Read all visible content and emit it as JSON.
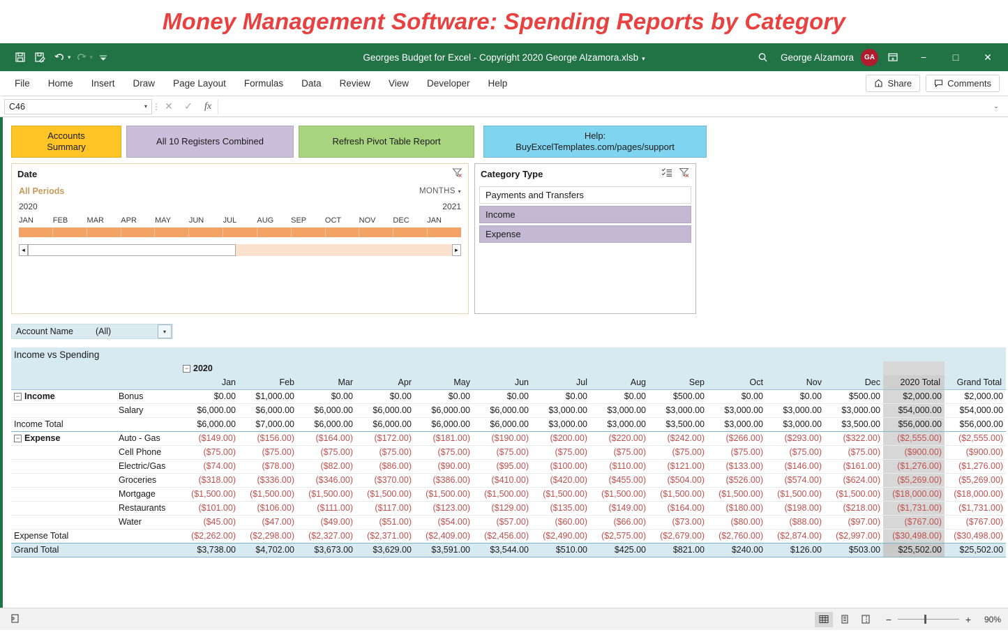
{
  "banner": {
    "title": "Money Management Software: Spending Reports by Category"
  },
  "titlebar": {
    "document_title": "Georges Budget for Excel - Copyright 2020 George Alzamora.xlsb",
    "title_caret": "▾",
    "quick_access": [
      {
        "name": "save-icon",
        "glyph": "Ὃe"
      },
      {
        "name": "save-as-icon",
        "glyph": "✎"
      },
      {
        "name": "undo-icon",
        "glyph": "↶"
      },
      {
        "name": "redo-icon",
        "glyph": "↷"
      },
      {
        "name": "customize-qat-icon",
        "glyph": "⌄"
      }
    ],
    "search_icon": "⚲",
    "user_name": "George Alzamora",
    "user_initials": "GA",
    "ribbon_display_icon": "⌧",
    "minimize": "−",
    "maximize": "□",
    "close": "✕"
  },
  "ribbon": {
    "tabs": [
      "File",
      "Home",
      "Insert",
      "Draw",
      "Page Layout",
      "Formulas",
      "Data",
      "Review",
      "View",
      "Developer",
      "Help"
    ],
    "share_label": "Share",
    "share_icon": "↪",
    "comments_label": "Comments",
    "comments_icon": "⬚"
  },
  "formula_bar": {
    "name_box": "C46",
    "name_box_caret": "▾",
    "cancel_icon": "✕",
    "confirm_icon": "✓",
    "function_icon": "fx",
    "formula_value": "",
    "expand_icon": "⌄"
  },
  "nav_buttons": [
    {
      "name": "accounts-summary-button",
      "line1": "Accounts",
      "line2": "Summary",
      "color": "#ffc425"
    },
    {
      "name": "all-registers-button",
      "line1": "All 10 Registers Combined",
      "line2": "",
      "color": "#cbbedb"
    },
    {
      "name": "refresh-pivot-button",
      "line1": "Refresh Pivot Table Report",
      "line2": "",
      "color": "#a9d47f"
    },
    {
      "name": "help-button",
      "line1": "Help:",
      "line2": "BuyExcelTemplates.com/pages/support",
      "color": "#7fd4ef"
    }
  ],
  "timeline_slicer": {
    "title": "Date",
    "clear_filter_icon": "∇",
    "all_periods": "All Periods",
    "level": "MONTHS",
    "level_caret": "▾",
    "year_start": "2020",
    "year_end": "2021",
    "months": [
      "JAN",
      "FEB",
      "MAR",
      "APR",
      "MAY",
      "JUN",
      "JUL",
      "AUG",
      "SEP",
      "OCT",
      "NOV",
      "DEC",
      "JAN"
    ],
    "scroll_left": "◄",
    "scroll_right": "►",
    "bar_color": "#f2a365"
  },
  "category_slicer": {
    "title": "Category Type",
    "multiselect_icon": "≣",
    "clear_filter_icon": "∇",
    "items": [
      {
        "label": "Payments and Transfers",
        "selected": false
      },
      {
        "label": "Income",
        "selected": true
      },
      {
        "label": "Expense",
        "selected": true
      }
    ]
  },
  "account_filter": {
    "label": "Account Name",
    "value": "(All)",
    "caret": "▾"
  },
  "chart_data": {
    "type": "table",
    "title": "Income vs Spending",
    "year_group": "2020",
    "year_collapse_glyph": "−",
    "columns": [
      "Jan",
      "Feb",
      "Mar",
      "Apr",
      "May",
      "Jun",
      "Jul",
      "Aug",
      "Sep",
      "Oct",
      "Nov",
      "Dec"
    ],
    "total_columns": [
      "2020 Total",
      "Grand Total"
    ],
    "groups": [
      {
        "name": "Income",
        "collapse_glyph": "−",
        "rows": [
          {
            "label": "Bonus",
            "values": [
              "$0.00",
              "$1,000.00",
              "$0.00",
              "$0.00",
              "$0.00",
              "$0.00",
              "$0.00",
              "$0.00",
              "$500.00",
              "$0.00",
              "$0.00",
              "$500.00"
            ],
            "year_total": "$2,000.00",
            "grand_total": "$2,000.00",
            "negative": false
          },
          {
            "label": "Salary",
            "values": [
              "$6,000.00",
              "$6,000.00",
              "$6,000.00",
              "$6,000.00",
              "$6,000.00",
              "$6,000.00",
              "$3,000.00",
              "$3,000.00",
              "$3,000.00",
              "$3,000.00",
              "$3,000.00",
              "$3,000.00"
            ],
            "year_total": "$54,000.00",
            "grand_total": "$54,000.00",
            "negative": false
          }
        ],
        "total_label": "Income Total",
        "total_values": [
          "$6,000.00",
          "$7,000.00",
          "$6,000.00",
          "$6,000.00",
          "$6,000.00",
          "$6,000.00",
          "$3,000.00",
          "$3,000.00",
          "$3,500.00",
          "$3,000.00",
          "$3,000.00",
          "$3,500.00"
        ],
        "total_year": "$56,000.00",
        "total_grand": "$56,000.00",
        "total_negative": false
      },
      {
        "name": "Expense",
        "collapse_glyph": "−",
        "rows": [
          {
            "label": "Auto - Gas",
            "values": [
              "($149.00)",
              "($156.00)",
              "($164.00)",
              "($172.00)",
              "($181.00)",
              "($190.00)",
              "($200.00)",
              "($220.00)",
              "($242.00)",
              "($266.00)",
              "($293.00)",
              "($322.00)"
            ],
            "year_total": "($2,555.00)",
            "grand_total": "($2,555.00)",
            "negative": true
          },
          {
            "label": "Cell Phone",
            "values": [
              "($75.00)",
              "($75.00)",
              "($75.00)",
              "($75.00)",
              "($75.00)",
              "($75.00)",
              "($75.00)",
              "($75.00)",
              "($75.00)",
              "($75.00)",
              "($75.00)",
              "($75.00)"
            ],
            "year_total": "($900.00)",
            "grand_total": "($900.00)",
            "negative": true
          },
          {
            "label": "Electric/Gas",
            "values": [
              "($74.00)",
              "($78.00)",
              "($82.00)",
              "($86.00)",
              "($90.00)",
              "($95.00)",
              "($100.00)",
              "($110.00)",
              "($121.00)",
              "($133.00)",
              "($146.00)",
              "($161.00)"
            ],
            "year_total": "($1,276.00)",
            "grand_total": "($1,276.00)",
            "negative": true
          },
          {
            "label": "Groceries",
            "values": [
              "($318.00)",
              "($336.00)",
              "($346.00)",
              "($370.00)",
              "($386.00)",
              "($410.00)",
              "($420.00)",
              "($455.00)",
              "($504.00)",
              "($526.00)",
              "($574.00)",
              "($624.00)"
            ],
            "year_total": "($5,269.00)",
            "grand_total": "($5,269.00)",
            "negative": true
          },
          {
            "label": "Mortgage",
            "values": [
              "($1,500.00)",
              "($1,500.00)",
              "($1,500.00)",
              "($1,500.00)",
              "($1,500.00)",
              "($1,500.00)",
              "($1,500.00)",
              "($1,500.00)",
              "($1,500.00)",
              "($1,500.00)",
              "($1,500.00)",
              "($1,500.00)"
            ],
            "year_total": "($18,000.00)",
            "grand_total": "($18,000.00)",
            "negative": true
          },
          {
            "label": "Restaurants",
            "values": [
              "($101.00)",
              "($106.00)",
              "($111.00)",
              "($117.00)",
              "($123.00)",
              "($129.00)",
              "($135.00)",
              "($149.00)",
              "($164.00)",
              "($180.00)",
              "($198.00)",
              "($218.00)"
            ],
            "year_total": "($1,731.00)",
            "grand_total": "($1,731.00)",
            "negative": true
          },
          {
            "label": "Water",
            "values": [
              "($45.00)",
              "($47.00)",
              "($49.00)",
              "($51.00)",
              "($54.00)",
              "($57.00)",
              "($60.00)",
              "($66.00)",
              "($73.00)",
              "($80.00)",
              "($88.00)",
              "($97.00)"
            ],
            "year_total": "($767.00)",
            "grand_total": "($767.00)",
            "negative": true
          }
        ],
        "total_label": "Expense Total",
        "total_values": [
          "($2,262.00)",
          "($2,298.00)",
          "($2,327.00)",
          "($2,371.00)",
          "($2,409.00)",
          "($2,456.00)",
          "($2,490.00)",
          "($2,575.00)",
          "($2,679.00)",
          "($2,760.00)",
          "($2,874.00)",
          "($2,997.00)"
        ],
        "total_year": "($30,498.00)",
        "total_grand": "($30,498.00)",
        "total_negative": true
      }
    ],
    "grand": {
      "label": "Grand Total",
      "values": [
        "$3,738.00",
        "$4,702.00",
        "$3,673.00",
        "$3,629.00",
        "$3,591.00",
        "$3,544.00",
        "$510.00",
        "$425.00",
        "$821.00",
        "$240.00",
        "$126.00",
        "$503.00"
      ],
      "year_total": "$25,502.00",
      "grand_total": "$25,502.00",
      "negative": false
    }
  },
  "status_bar": {
    "macro_record_icon": "▤",
    "views": [
      {
        "name": "normal-view-button",
        "glyph": "▦",
        "active": true
      },
      {
        "name": "page-layout-view-button",
        "glyph": "▥",
        "active": false
      },
      {
        "name": "page-break-view-button",
        "glyph": "▧",
        "active": false
      }
    ],
    "zoom_out": "−",
    "zoom_in": "+",
    "zoom_level": "90%"
  }
}
